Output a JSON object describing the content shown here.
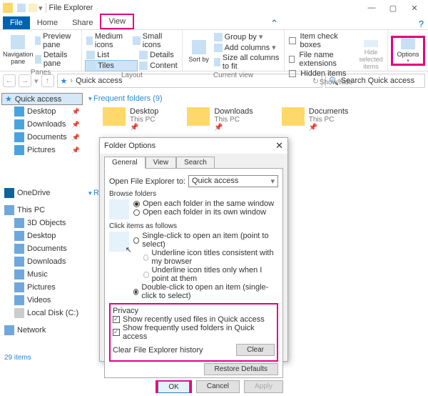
{
  "window": {
    "title": "File Explorer"
  },
  "ribbontabs": {
    "file": "File",
    "home": "Home",
    "share": "Share",
    "view": "View"
  },
  "ribbon": {
    "panes": {
      "label": "Panes",
      "navigation": "Navigation pane",
      "preview": "Preview pane",
      "details": "Details pane"
    },
    "layout": {
      "label": "Layout",
      "medium": "Medium icons",
      "small": "Small icons",
      "list": "List",
      "details": "Details",
      "tiles": "Tiles",
      "content": "Content"
    },
    "current": {
      "label": "Current view",
      "sort": "Sort by",
      "group": "Group by",
      "addcols": "Add columns",
      "sizeall": "Size all columns to fit"
    },
    "showhide": {
      "label": "Show/hide",
      "chk": "Item check boxes",
      "ext": "File name extensions",
      "hidden": "Hidden items",
      "hidesel": "Hide selected items"
    },
    "options": "Options"
  },
  "addr": {
    "path": "Quick access"
  },
  "search": {
    "placeholder": "Search Quick access"
  },
  "sidebar": {
    "onedrive": "OneDrive",
    "thispc": "This PC",
    "network": "Network",
    "qa": {
      "quick": "Quick access",
      "desktop": "Desktop",
      "downloads": "Downloads",
      "documents": "Documents",
      "pictures": "Pictures"
    },
    "pc": {
      "obj": "3D Objects",
      "desktop": "Desktop",
      "documents": "Documents",
      "downloads": "Downloads",
      "music": "Music",
      "pictures": "Pictures",
      "videos": "Videos",
      "disk": "Local Disk (C:)"
    }
  },
  "content": {
    "freq": "Frequent folders (9)",
    "rec": "Rece",
    "folders": [
      {
        "name": "Desktop",
        "loc": "This PC"
      },
      {
        "name": "Downloads",
        "loc": "This PC"
      },
      {
        "name": "Documents",
        "loc": "This PC"
      }
    ]
  },
  "status": {
    "items": "29 items"
  },
  "dialog": {
    "title": "Folder Options",
    "tabs": {
      "general": "General",
      "view": "View",
      "search": "Search"
    },
    "open": {
      "label": "Open File Explorer to:",
      "value": "Quick access"
    },
    "browse": {
      "label": "Browse folders",
      "same": "Open each folder in the same window",
      "own": "Open each folder in its own window"
    },
    "click": {
      "label": "Click items as follows",
      "single": "Single-click to open an item (point to select)",
      "u1": "Underline icon titles consistent with my browser",
      "u2": "Underline icon titles only when I point at them",
      "double": "Double-click to open an item (single-click to select)"
    },
    "privacy": {
      "label": "Privacy",
      "recent": "Show recently used files in Quick access",
      "freq": "Show frequently used folders in Quick access",
      "clearhist": "Clear File Explorer history",
      "clear": "Clear"
    },
    "restore": "Restore Defaults",
    "ok": "OK",
    "cancel": "Cancel",
    "apply": "Apply"
  }
}
